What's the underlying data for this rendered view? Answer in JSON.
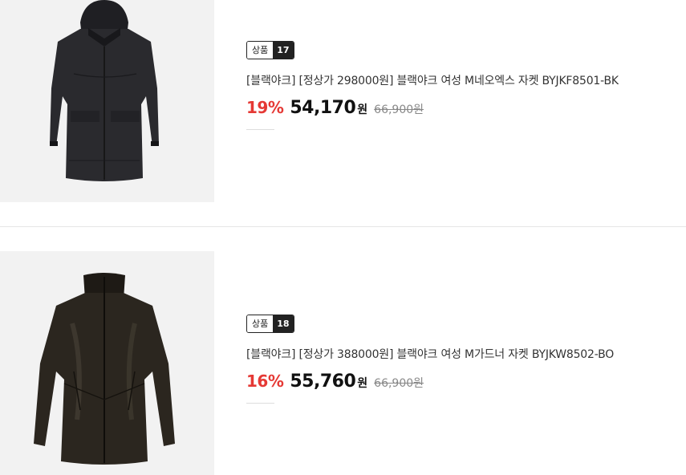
{
  "products": [
    {
      "badge_label": "상품",
      "badge_number": "17",
      "title": "[블랙야크] [정상가 298000원] 블랙야크 여성 M네오엑스 자켓 BYJKF8501-BK",
      "discount": "19%",
      "sale_price": "54,170",
      "currency": "원",
      "original_price": "66,900원"
    },
    {
      "badge_label": "상품",
      "badge_number": "18",
      "title": "[블랙야크] [정상가 388000원] 블랙야크 여성 M가드너 자켓 BYJKW8502-BO",
      "discount": "16%",
      "sale_price": "55,760",
      "currency": "원",
      "original_price": "66,900원"
    }
  ],
  "colors": {
    "discount": "#e53935",
    "thumb_bg": "#f2f2f2",
    "jacket1": "#2a2a2e",
    "jacket2": "#2b261f"
  }
}
